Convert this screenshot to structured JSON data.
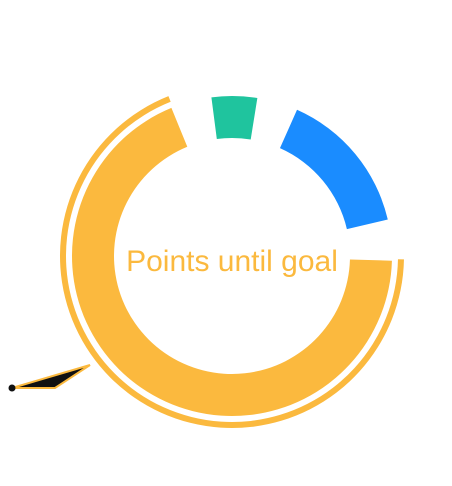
{
  "chart_data": {
    "type": "pie",
    "variant": "donut",
    "title": "",
    "center_label": "Points until goal",
    "center_label_color": "#fbb93e",
    "slices": [
      {
        "value": 0.745,
        "color": "#fbb93e",
        "highlighted": true
      },
      {
        "value": 0.05,
        "color": "#1fc49e",
        "highlighted": false
      },
      {
        "value": 0.16,
        "color": "#1a8cff",
        "highlighted": false
      }
    ],
    "gap_fraction": 0.045,
    "start_angle_deg": -5,
    "legend": "none",
    "data_labels": "none"
  }
}
